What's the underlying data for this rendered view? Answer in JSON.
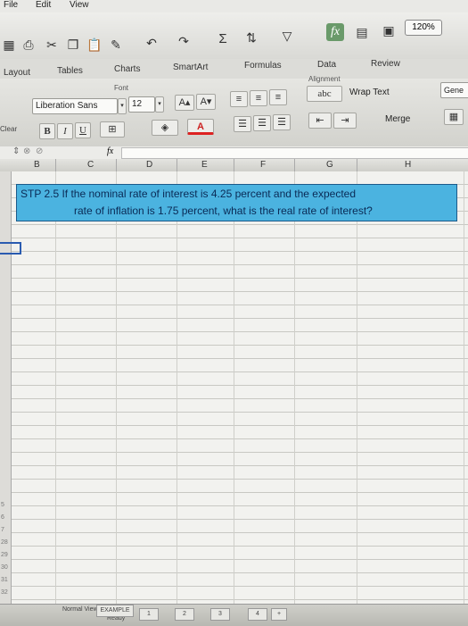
{
  "menubar": {
    "items": [
      "File",
      "Edit",
      "View"
    ]
  },
  "toolbar": {
    "zoom": "120%",
    "fx_label": "fx",
    "sigma": "Σ"
  },
  "ribbon_tabs": [
    "Layout",
    "Tables",
    "Charts",
    "SmartArt",
    "Formulas",
    "Data",
    "Review"
  ],
  "ribbon": {
    "font_group_label": "Font",
    "alignment_group_label": "Alignment",
    "font_name": "Liberation Sans",
    "font_size": "12",
    "grow_font": "A▴",
    "shrink_font": "A▾",
    "bold": "B",
    "italic": "I",
    "underline": "U",
    "font_color": "A",
    "abc": "abc",
    "wrap_text": "Wrap Text",
    "merge": "Merge",
    "clear": "Clear",
    "number_format": "Gene"
  },
  "formula_bar": {
    "fx": "fx"
  },
  "columns": [
    "B",
    "C",
    "D",
    "E",
    "F",
    "G",
    "H"
  ],
  "question": {
    "line1": "STP 2.5  If the nominal rate of interest is 4.25 percent and the expected",
    "line2": "rate of inflation is 1.75 percent, what is the real rate of interest?"
  },
  "row_numbers": [
    "5",
    "6",
    "7",
    "28",
    "29",
    "30",
    "31",
    "32"
  ],
  "statusbar": {
    "view": "Normal View",
    "ready": "Ready",
    "sheet": "EXAMPLE",
    "tabs": [
      "1",
      "2",
      "3",
      "4"
    ]
  },
  "colors": {
    "question_fill": "#4bb3e0",
    "question_border": "#1c5a8a",
    "fx_button": "#6a9a6a",
    "selection": "#2a5bb0"
  }
}
